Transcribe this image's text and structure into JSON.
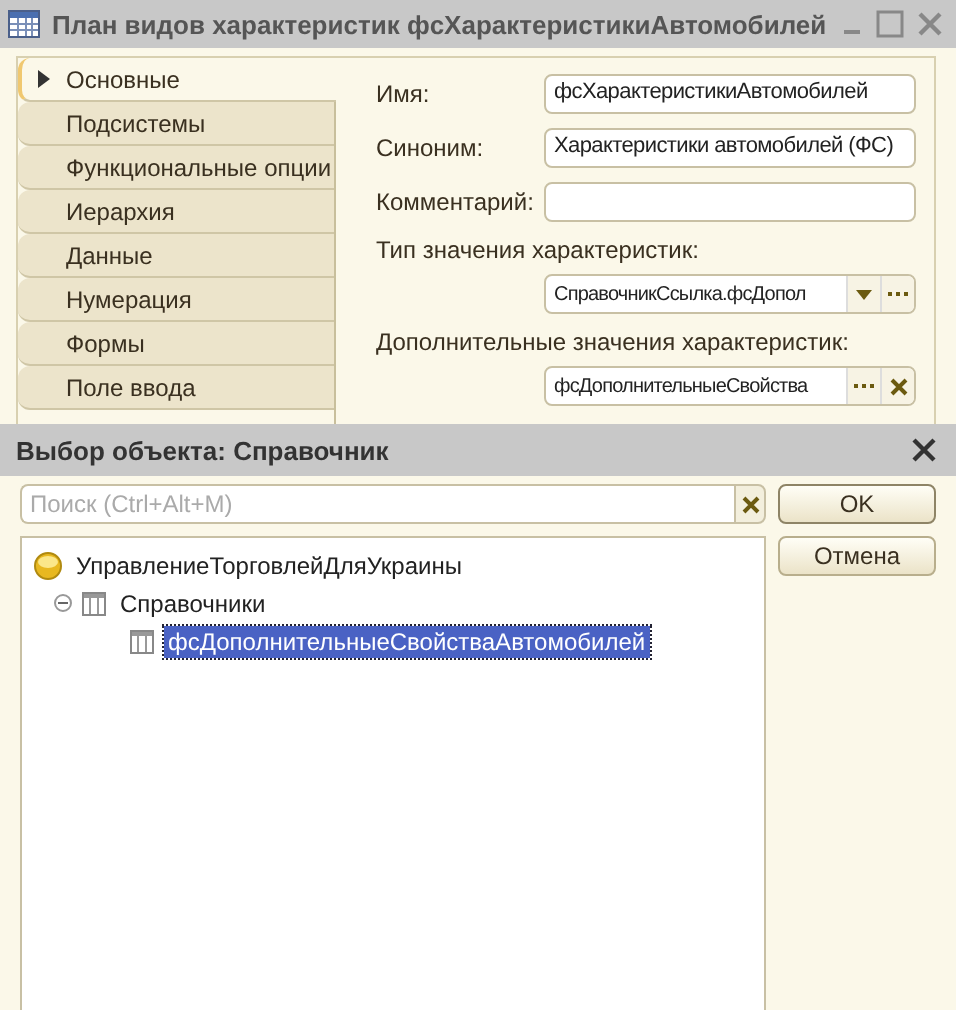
{
  "window": {
    "title": "План видов характеристик фсХарактеристикиАвтомобилей"
  },
  "tabs": [
    {
      "label": "Основные",
      "selected": true
    },
    {
      "label": "Подсистемы",
      "selected": false
    },
    {
      "label": "Функциональные опции",
      "selected": false
    },
    {
      "label": "Иерархия",
      "selected": false
    },
    {
      "label": "Данные",
      "selected": false
    },
    {
      "label": "Нумерация",
      "selected": false
    },
    {
      "label": "Формы",
      "selected": false
    },
    {
      "label": "Поле ввода",
      "selected": false
    }
  ],
  "fields": [
    {
      "kind": "inline",
      "label": "Имя:",
      "value": "фсХарактеристикиАвтомобилей"
    },
    {
      "kind": "inline",
      "label": "Синоним:",
      "value": "Характеристики автомобилей (ФС)"
    },
    {
      "kind": "inline",
      "label": "Комментарий:"
    },
    {
      "kind": "dropdown",
      "label": "Тип значения характеристик:",
      "value": "СправочникСсылка.фсДопол"
    },
    {
      "kind": "clearable",
      "label": "Дополнительные значения характеристик:",
      "value": "фсДополнительныеСвойства"
    }
  ],
  "dialog": {
    "title": "Выбор объекта: Справочник",
    "search": {
      "placeholder": "Поиск (Ctrl+Alt+M)"
    },
    "buttons": [
      "OK",
      "Отмена"
    ],
    "tree": [
      {
        "label": "УправлениеТорговлейДляУкраины",
        "kind": "config",
        "selected": false,
        "children": [
          {
            "label": "Справочники",
            "kind": "group",
            "selected": false,
            "expanded": true,
            "children": [
              {
                "label": "фсДополнительныеСвойстваАвтомобилей",
                "kind": "catalog",
                "selected": true
              }
            ]
          }
        ]
      }
    ]
  }
}
